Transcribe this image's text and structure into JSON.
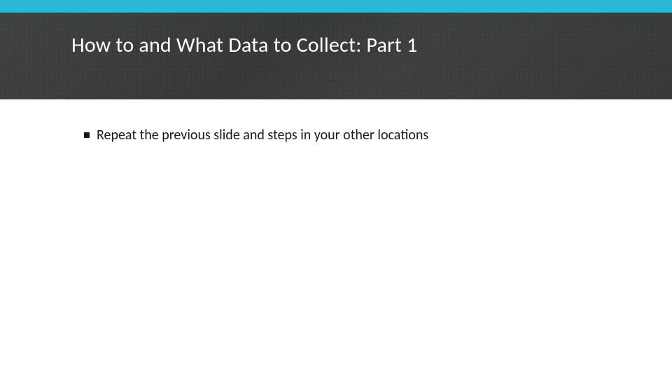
{
  "colors": {
    "accent": "#29b8d6",
    "band": "#3a3c3b",
    "text": "#1a1a1a",
    "title": "#ffffff"
  },
  "header": {
    "title": "How to and What Data to Collect: Part 1"
  },
  "content": {
    "bullets": [
      {
        "text": "Repeat the previous slide and steps in your other locations"
      }
    ]
  }
}
